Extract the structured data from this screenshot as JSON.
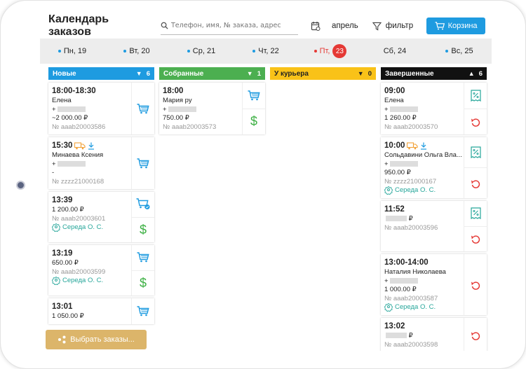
{
  "app": {
    "title": "Календарь заказов",
    "search_placeholder": "Телефон, имя, № заказа, адрес",
    "month_label": "апрель",
    "filter_label": "фильтр",
    "cart_label": "Корзина",
    "select_orders_label": "Выбрать заказы..."
  },
  "days": [
    {
      "label": "Пн, 19"
    },
    {
      "label": "Вт, 20"
    },
    {
      "label": "Ср, 21"
    },
    {
      "label": "Чт, 22"
    },
    {
      "label": "Пт,",
      "num": "23"
    },
    {
      "label": "Сб, 24"
    },
    {
      "label": "Вс, 25"
    }
  ],
  "columns": [
    {
      "title": "Новые",
      "count": "6",
      "color": "#1e9be0",
      "arrow": "▼",
      "cards": [
        {
          "time": "18:00-18:30",
          "name": "Елена",
          "phone": "+",
          "amount": "~2 000.00 ₽",
          "order": "№ aaab20003586",
          "actions": [
            "cart-icon"
          ]
        },
        {
          "time": "15:30",
          "name": "Минаева Ксения",
          "phone": "+",
          "amount": "-",
          "order": "№ zzzz21000168",
          "actions": [
            "cart-icon"
          ],
          "extra_icons": true
        },
        {
          "time": "13:39",
          "amount": "1 200.00 ₽",
          "order": "№ aaab20003601",
          "courier": "Середа О. С.",
          "actions": [
            "cart-check-icon",
            "dollar-icon"
          ]
        },
        {
          "time": "13:19",
          "amount": "650.00 ₽",
          "order": "№ aaab20003599",
          "courier": "Середа О. С.",
          "actions": [
            "cart-icon",
            "dollar-icon"
          ]
        },
        {
          "time": "13:01",
          "amount": "1 050.00 ₽",
          "actions": [
            "cart-icon"
          ]
        }
      ]
    },
    {
      "title": "Собранные",
      "count": "1",
      "color": "#4caf50",
      "arrow": "▼",
      "cards": [
        {
          "time": "18:00",
          "name": "Мария ру",
          "phone": "+",
          "amount": "750.00 ₽",
          "order": "№ aaab20003573",
          "actions": [
            "cart-icon",
            "dollar-icon"
          ]
        }
      ]
    },
    {
      "title": "У курьера",
      "count": "0",
      "color": "#f9c218",
      "arrow": "▼",
      "cards": []
    },
    {
      "title": "Завершенные",
      "count": "6",
      "color": "#111111",
      "arrow": "▲",
      "cards": [
        {
          "time": "09:00",
          "name": "Елена",
          "phone": "+",
          "amount": "1 260.00 ₽",
          "order": "№ aaab20003570",
          "actions": [
            "receipt-icon",
            "undo-icon"
          ]
        },
        {
          "time": "10:00",
          "name": "Сольдавини Ольга Вла...",
          "phone": "+",
          "amount": "950.00 ₽",
          "order": "№ zzzz21000167",
          "courier": "Середа О. С.",
          "actions": [
            "receipt-icon",
            "undo-icon"
          ],
          "extra_icons": true
        },
        {
          "time": "11:52",
          "amount": "₽",
          "order": "№ aaab20003596",
          "actions": [
            "receipt-icon",
            "undo-icon"
          ]
        },
        {
          "time": "13:00-14:00",
          "name": "Наталия Николаева",
          "phone": "+",
          "amount": "1 000.00 ₽",
          "order": "№ aaab20003587",
          "courier": "Середа О. С.",
          "actions": [
            "undo-icon"
          ]
        },
        {
          "time": "13:02",
          "amount": "₽",
          "order": "№ aaab20003598",
          "actions": [
            "undo-icon"
          ]
        }
      ]
    }
  ]
}
